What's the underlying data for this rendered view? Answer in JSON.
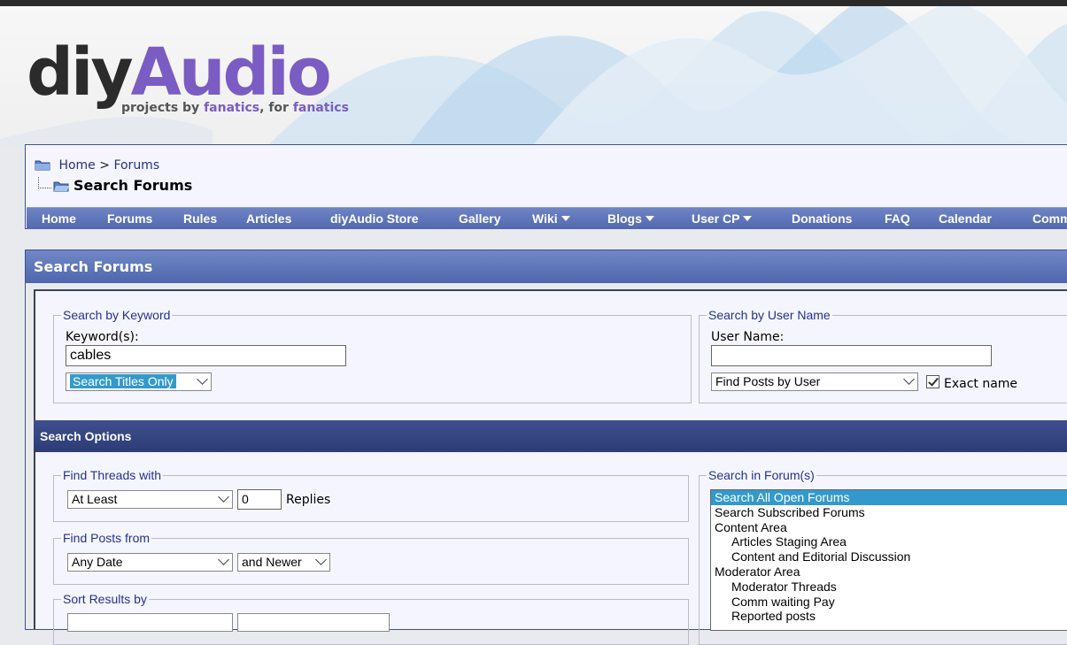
{
  "logo": {
    "diy": "diy",
    "audio": "Audio",
    "tag_pre": "projects by ",
    "tag_f1": "fanatics",
    "tag_mid": ", for ",
    "tag_f2": "fanatics"
  },
  "breadcrumb": {
    "home": "Home",
    "sep": ">",
    "forums": "Forums",
    "title": "Search Forums"
  },
  "nav": [
    {
      "label": "Home"
    },
    {
      "label": "Forums"
    },
    {
      "label": "Rules"
    },
    {
      "label": "Articles"
    },
    {
      "label": "diyAudio Store"
    },
    {
      "label": "Gallery"
    },
    {
      "label": "Wiki"
    },
    {
      "label": "Blogs"
    },
    {
      "label": "User CP"
    },
    {
      "label": "Donations"
    },
    {
      "label": "FAQ"
    },
    {
      "label": "Calendar"
    },
    {
      "label": "Comm"
    }
  ],
  "panel": {
    "title": "Search Forums"
  },
  "keyword": {
    "legend": "Search by Keyword",
    "label": "Keyword(s):",
    "value": "cables",
    "mode": "Search Titles Only"
  },
  "username": {
    "legend": "Search by User Name",
    "label": "User Name:",
    "value": "",
    "mode": "Find Posts by User",
    "exact_label": "Exact name",
    "exact_checked": true
  },
  "options": {
    "title": "Search Options",
    "threads": {
      "legend": "Find Threads with",
      "qualifier": "At Least",
      "count": "0",
      "unit": "Replies"
    },
    "posts": {
      "legend": "Find Posts from",
      "date": "Any Date",
      "direction": "and Newer"
    },
    "sort": {
      "legend": "Sort Results by"
    }
  },
  "forums": {
    "legend": "Search in Forum(s)",
    "items": [
      {
        "label": "Search All Open Forums"
      },
      {
        "label": "Search Subscribed Forums"
      },
      {
        "label": "Content Area"
      },
      {
        "label": "Articles Staging Area"
      },
      {
        "label": "Content and Editorial Discussion"
      },
      {
        "label": "Moderator Area"
      },
      {
        "label": "Moderator Threads"
      },
      {
        "label": "Comm waiting Pay"
      },
      {
        "label": "Reported posts"
      }
    ]
  },
  "colors": {
    "accent": "#7a5cc2",
    "nav": "#5268b0",
    "selection": "#3399cc",
    "link": "#22338a"
  }
}
